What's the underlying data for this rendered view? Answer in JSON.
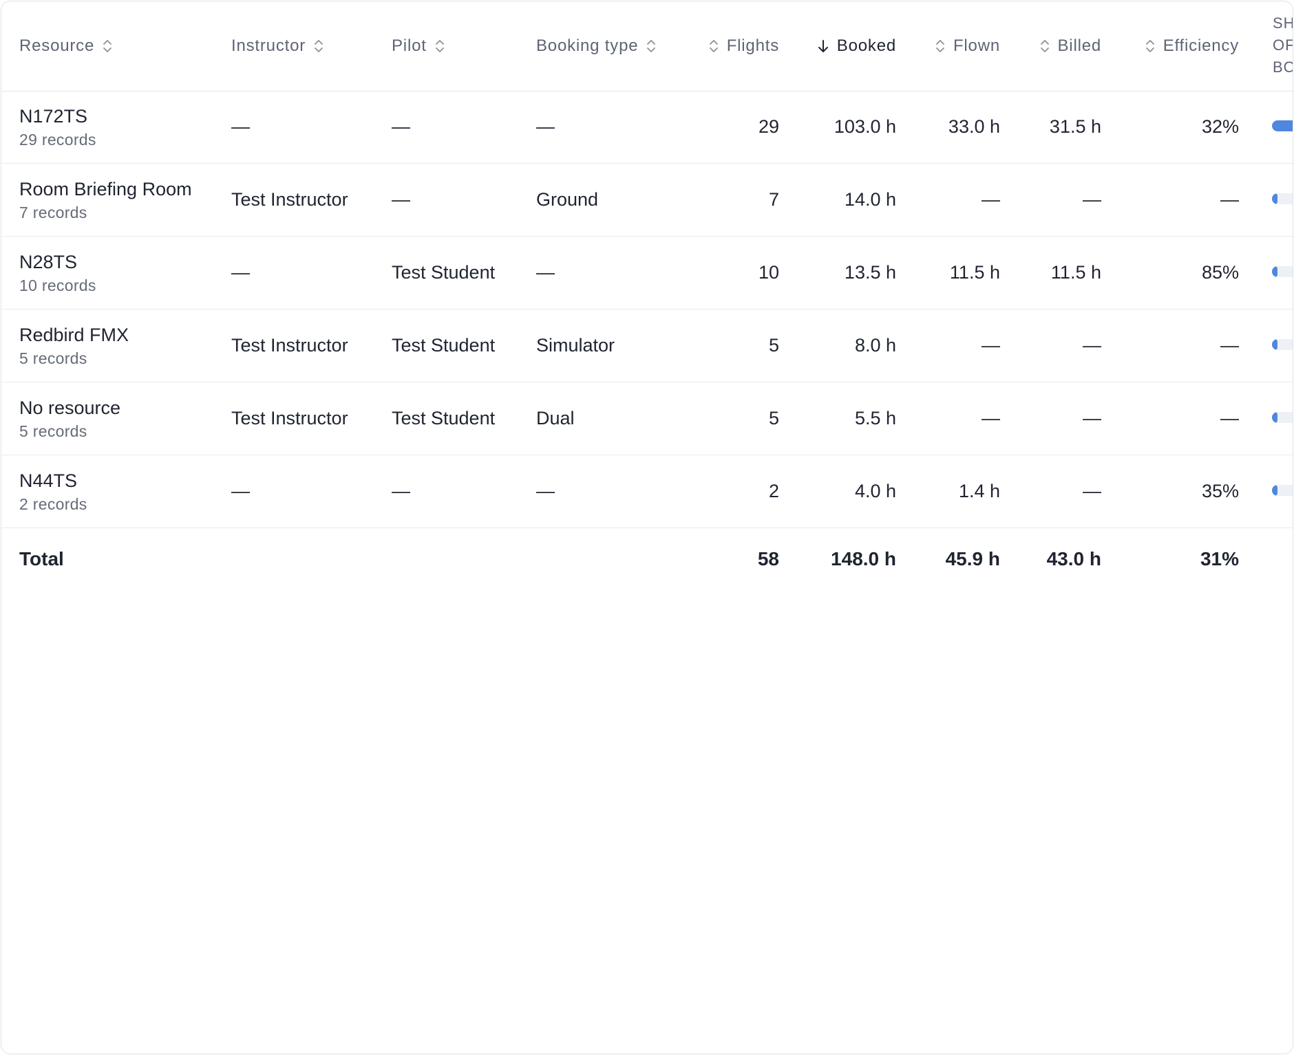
{
  "table": {
    "columns": {
      "resource": "Resource",
      "instructor": "Instructor",
      "pilot": "Pilot",
      "booking_type": "Booking type",
      "flights": "Flights",
      "booked": "Booked",
      "flown": "Flown",
      "billed": "Billed",
      "efficiency": "Efficiency",
      "share_line1": "SH",
      "share_line2": "OF",
      "share_line3": "BO"
    },
    "sorted_column": "Booked",
    "sort_direction": "descending",
    "rows": [
      {
        "resource": "N172TS",
        "records": "29 records",
        "instructor": "—",
        "pilot": "—",
        "booking_type": "—",
        "flights": "29",
        "booked": "103.0 h",
        "flown": "33.0 h",
        "billed": "31.5 h",
        "efficiency": "32%",
        "share": 0.7
      },
      {
        "resource": "Room Briefing Room",
        "records": "7 records",
        "instructor": "Test Instructor",
        "pilot": "—",
        "booking_type": "Ground",
        "flights": "7",
        "booked": "14.0 h",
        "flown": "—",
        "billed": "—",
        "efficiency": "—",
        "share": 0.095
      },
      {
        "resource": "N28TS",
        "records": "10 records",
        "instructor": "—",
        "pilot": "Test Student",
        "booking_type": "—",
        "flights": "10",
        "booked": "13.5 h",
        "flown": "11.5 h",
        "billed": "11.5 h",
        "efficiency": "85%",
        "share": 0.091
      },
      {
        "resource": "Redbird FMX",
        "records": "5 records",
        "instructor": "Test Instructor",
        "pilot": "Test Student",
        "booking_type": "Simulator",
        "flights": "5",
        "booked": "8.0 h",
        "flown": "—",
        "billed": "—",
        "efficiency": "—",
        "share": 0.054
      },
      {
        "resource": "No resource",
        "records": "5 records",
        "instructor": "Test Instructor",
        "pilot": "Test Student",
        "booking_type": "Dual",
        "flights": "5",
        "booked": "5.5 h",
        "flown": "—",
        "billed": "—",
        "efficiency": "—",
        "share": 0.037
      },
      {
        "resource": "N44TS",
        "records": "2 records",
        "instructor": "—",
        "pilot": "—",
        "booking_type": "—",
        "flights": "2",
        "booked": "4.0 h",
        "flown": "1.4 h",
        "billed": "—",
        "efficiency": "35%",
        "share": 0.027
      }
    ],
    "total": {
      "label": "Total",
      "flights": "58",
      "booked": "148.0 h",
      "flown": "45.9 h",
      "billed": "43.0 h",
      "efficiency": "31%"
    }
  },
  "colors": {
    "accent": "#4f87dc",
    "track": "#edf0f4",
    "header_text": "#5d6473",
    "body_text": "#1f2430"
  }
}
